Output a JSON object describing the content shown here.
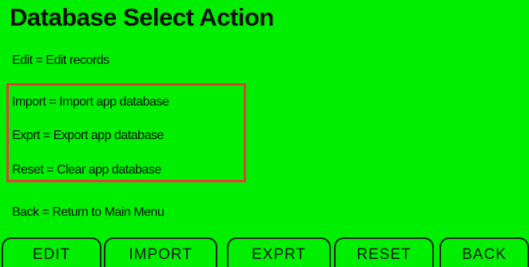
{
  "screen": {
    "title": "Database Select Action",
    "background_color": "#00ee00",
    "highlight_color": "#e43b3b"
  },
  "help_lines": [
    "Edit = Edit records",
    "Import = Import app database",
    "Exprt = Export app database",
    "Reset = Clear app database",
    "Back = Return to Main Menu"
  ],
  "buttons": [
    "EDIT",
    "IMPORT",
    "EXPRT",
    "RESET",
    "BACK"
  ]
}
